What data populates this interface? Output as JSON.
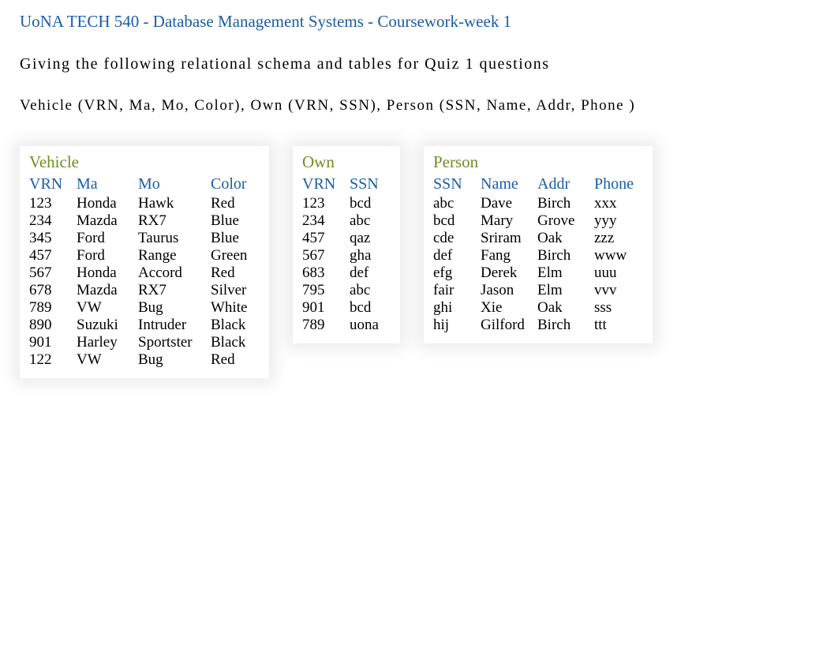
{
  "title": "UoNA TECH 540 - Database Management Systems - Coursework-week 1",
  "instruction": "Giving the following relational schema and tables for Quiz 1 questions",
  "schema": "Vehicle (VRN, Ma, Mo, Color),  Own (VRN, SSN),  Person (SSN, Name, Addr, Phone )",
  "tables": {
    "vehicle": {
      "name": "Vehicle",
      "headers": [
        "VRN",
        "Ma",
        "Mo",
        "Color"
      ],
      "rows": [
        [
          "123",
          "Honda",
          "Hawk",
          "Red"
        ],
        [
          "234",
          "Mazda",
          "RX7",
          "Blue"
        ],
        [
          "345",
          "Ford",
          "Taurus",
          "Blue"
        ],
        [
          "457",
          "Ford",
          "Range",
          "Green"
        ],
        [
          "567",
          "Honda",
          "Accord",
          "Red"
        ],
        [
          "678",
          "Mazda",
          "RX7",
          "Silver"
        ],
        [
          "789",
          "VW",
          "Bug",
          "White"
        ],
        [
          "890",
          "Suzuki",
          "Intruder",
          "Black"
        ],
        [
          "901",
          "Harley",
          "Sportster",
          "Black"
        ],
        [
          "122",
          "VW",
          "Bug",
          "Red"
        ]
      ]
    },
    "own": {
      "name": "Own",
      "headers": [
        "VRN",
        "SSN"
      ],
      "rows": [
        [
          "123",
          "bcd"
        ],
        [
          "234",
          "abc"
        ],
        [
          "457",
          "qaz"
        ],
        [
          "567",
          "gha"
        ],
        [
          "683",
          "def"
        ],
        [
          "795",
          "abc"
        ],
        [
          "901",
          "bcd"
        ],
        [
          "789",
          "uona"
        ]
      ]
    },
    "person": {
      "name": "Person",
      "headers": [
        "SSN",
        "Name",
        "Addr",
        "Phone"
      ],
      "rows": [
        [
          "abc",
          "Dave",
          "Birch",
          "xxx"
        ],
        [
          "bcd",
          "Mary",
          "Grove",
          "yyy"
        ],
        [
          "cde",
          "Sriram",
          "Oak",
          "zzz"
        ],
        [
          "def",
          "Fang",
          "Birch",
          "www"
        ],
        [
          "efg",
          "Derek",
          "Elm",
          "uuu"
        ],
        [
          "fair",
          "Jason",
          "Elm",
          "vvv"
        ],
        [
          "ghi",
          "Xie",
          "Oak",
          "sss"
        ],
        [
          "hij",
          "Gilford",
          "Birch",
          "ttt"
        ]
      ]
    }
  }
}
